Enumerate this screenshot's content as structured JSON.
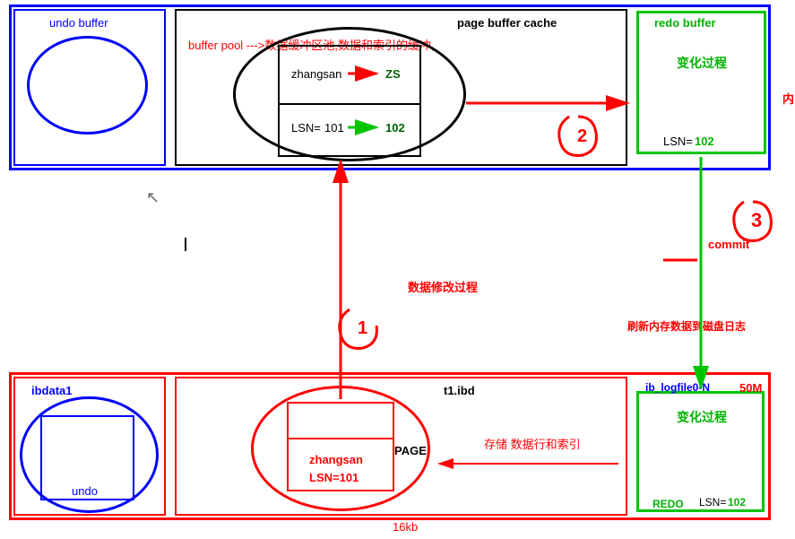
{
  "upper": {
    "undo_buffer": "undo buffer",
    "page_buffer_cache": "page buffer cache",
    "redo_buffer": "redo buffer",
    "buffer_pool_desc": "buffer pool --->数据缓冲区池,数据和索引的缓冲,",
    "zhangsan": "zhangsan",
    "zs": "ZS",
    "lsn_label": "LSN=",
    "lsn_101": "101",
    "lsn_102": "102",
    "redo_change": "变化过程",
    "redo_lsn_label": "LSN=",
    "redo_lsn_val": "102",
    "memory_side": "内"
  },
  "middle": {
    "process_title": "数据修改过程",
    "commit": "commit",
    "flush_desc": "刷新内存数据到磁盘日志",
    "step1": "1",
    "step2": "2",
    "step3": "3"
  },
  "lower": {
    "ibdata1": "ibdata1",
    "undo": "undo",
    "t1_ibd": "t1.ibd",
    "page": "PAGE",
    "zhangsan": "zhangsan",
    "lsn_101": "LSN=101",
    "storage_desc": "存储 数据行和索引",
    "size_16kb": "16kb",
    "ib_logfile": "ib_logfile0-N",
    "size_50m": "50M",
    "change": "变化过程",
    "redo": "REDO",
    "lsn_label": "LSN=",
    "lsn_val": "102"
  }
}
